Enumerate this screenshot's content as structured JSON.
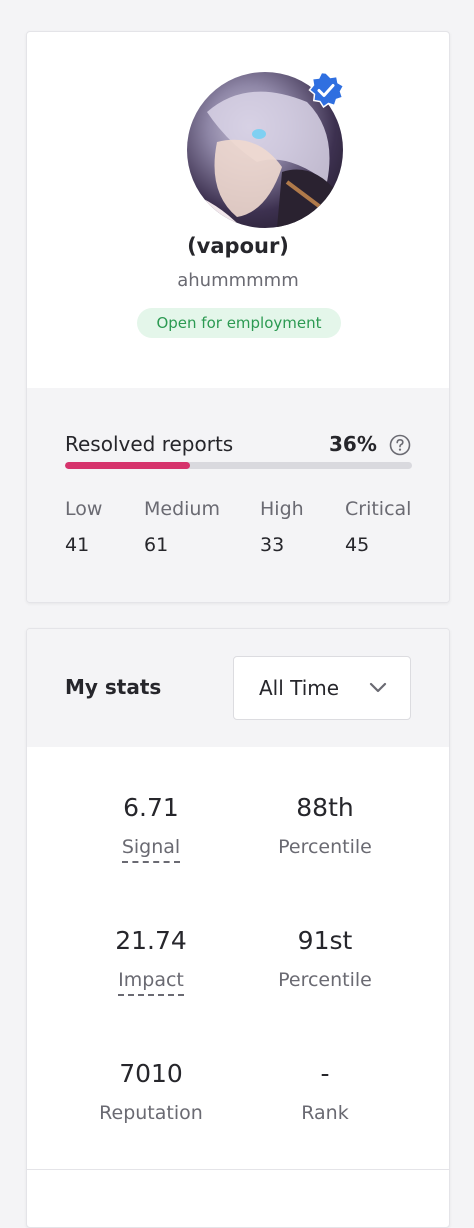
{
  "profile": {
    "display_name": "(vapour)",
    "username": "ahummmmm",
    "employment_badge": "Open for employment",
    "verified": true
  },
  "resolved": {
    "label": "Resolved reports",
    "percent_text": "36%",
    "percent": 36,
    "severities": [
      {
        "label": "Low",
        "value": "41"
      },
      {
        "label": "Medium",
        "value": "61"
      },
      {
        "label": "High",
        "value": "33"
      },
      {
        "label": "Critical",
        "value": "45"
      }
    ]
  },
  "stats": {
    "title": "My stats",
    "time_range": "All Time",
    "items": [
      {
        "value": "6.71",
        "label": "Signal"
      },
      {
        "value": "88th",
        "label": "Percentile"
      },
      {
        "value": "21.74",
        "label": "Impact"
      },
      {
        "value": "91st",
        "label": "Percentile"
      },
      {
        "value": "7010",
        "label": "Reputation"
      },
      {
        "value": "-",
        "label": "Rank"
      }
    ]
  },
  "colors": {
    "accent": "#d6336c",
    "badge_bg": "#e4f6ea",
    "badge_text": "#2c9a52",
    "verified": "#2f6fe0"
  },
  "icons": [
    "verified-icon",
    "help-icon",
    "chevron-down-icon"
  ]
}
